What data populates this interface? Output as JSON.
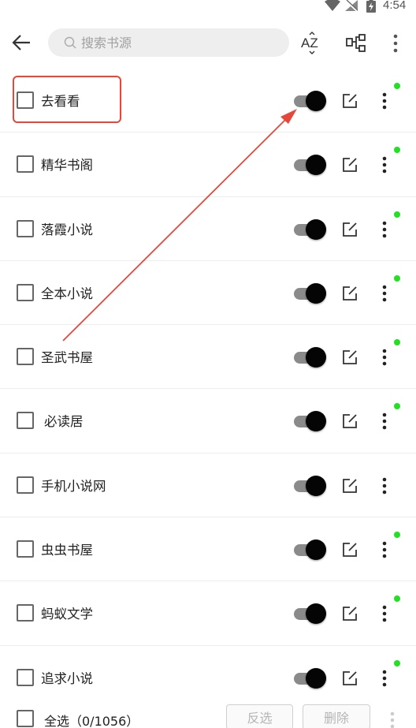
{
  "status_bar": {
    "time": "4:54",
    "icons": [
      "wifi-icon",
      "no-signal-icon",
      "battery-charging-icon"
    ]
  },
  "toolbar": {
    "back_icon": "arrow-left-icon",
    "search": {
      "placeholder": "搜索书源",
      "value": ""
    },
    "sort_label": "AZ",
    "group_icon": "group-icon",
    "more_icon": "more-vertical-icon"
  },
  "sources": [
    {
      "name": "去看看",
      "enabled": true,
      "has_dot": true
    },
    {
      "name": "精华书阁",
      "enabled": true,
      "has_dot": true
    },
    {
      "name": "落霞小说",
      "enabled": true,
      "has_dot": true
    },
    {
      "name": "全本小说",
      "enabled": true,
      "has_dot": true
    },
    {
      "name": "圣武书屋",
      "enabled": true,
      "has_dot": true
    },
    {
      "name": "必读居",
      "enabled": true,
      "has_dot": true
    },
    {
      "name": "手机小说网",
      "enabled": true,
      "has_dot": false
    },
    {
      "name": "虫虫书屋",
      "enabled": true,
      "has_dot": true
    },
    {
      "name": "蚂蚁文学",
      "enabled": true,
      "has_dot": true
    },
    {
      "name": "追求小说",
      "enabled": true,
      "has_dot": true
    }
  ],
  "bottom_bar": {
    "select_all_label": "全选（0/1056）",
    "invert_label": "反选",
    "delete_label": "删除"
  },
  "colors": {
    "annotation": "#e5483a",
    "status_dot": "#22e022",
    "toggle_thumb": "#050505"
  }
}
